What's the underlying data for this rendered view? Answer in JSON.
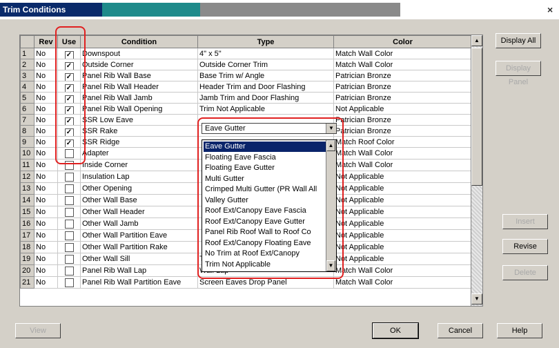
{
  "window": {
    "title": "Trim Conditions",
    "close_glyph": "×"
  },
  "grid": {
    "columns": [
      "",
      "Rev",
      "Use",
      "Condition",
      "Type",
      "Color"
    ],
    "rows": [
      {
        "n": "1",
        "rev": "No",
        "use": true,
        "condition": "Downspout",
        "type": "4\" x 5\"",
        "color": "Match Wall Color"
      },
      {
        "n": "2",
        "rev": "No",
        "use": true,
        "condition": "Outside Corner",
        "type": "Outside Corner Trim",
        "color": "Match Wall Color"
      },
      {
        "n": "3",
        "rev": "No",
        "use": true,
        "condition": "Panel Rib Wall Base",
        "type": "Base Trim w/ Angle",
        "color": "Patrician Bronze"
      },
      {
        "n": "4",
        "rev": "No",
        "use": true,
        "condition": "Panel Rib Wall Header",
        "type": "Header Trim and Door Flashing",
        "color": "Patrician Bronze"
      },
      {
        "n": "5",
        "rev": "No",
        "use": true,
        "condition": "Panel Rib Wall Jamb",
        "type": "Jamb Trim and Door Flashing",
        "color": "Patrician Bronze"
      },
      {
        "n": "6",
        "rev": "No",
        "use": true,
        "condition": "Panel Rib Wall Opening",
        "type": "Trim Not Applicable",
        "color": "Not Applicable"
      },
      {
        "n": "7",
        "rev": "No",
        "use": true,
        "condition": "SSR Low Eave",
        "type": "",
        "color": "Patrician Bronze"
      },
      {
        "n": "8",
        "rev": "No",
        "use": true,
        "condition": "SSR Rake",
        "type": "",
        "color": "Patrician Bronze"
      },
      {
        "n": "9",
        "rev": "No",
        "use": true,
        "condition": "SSR Ridge",
        "type": "",
        "color": "Match Roof Color"
      },
      {
        "n": "10",
        "rev": "No",
        "use": false,
        "condition": "Adapter",
        "type": "",
        "color": "Match Wall Color"
      },
      {
        "n": "11",
        "rev": "No",
        "use": false,
        "condition": "Inside Corner",
        "type": "",
        "color": "Match Wall Color"
      },
      {
        "n": "12",
        "rev": "No",
        "use": false,
        "condition": "Insulation Lap",
        "type": "",
        "color": "Not Applicable"
      },
      {
        "n": "13",
        "rev": "No",
        "use": false,
        "condition": "Other Opening",
        "type": "",
        "color": "Not Applicable"
      },
      {
        "n": "14",
        "rev": "No",
        "use": false,
        "condition": "Other Wall Base",
        "type": "",
        "color": "Not Applicable"
      },
      {
        "n": "15",
        "rev": "No",
        "use": false,
        "condition": "Other Wall Header",
        "type": "",
        "color": "Not Applicable"
      },
      {
        "n": "16",
        "rev": "No",
        "use": false,
        "condition": "Other Wall Jamb",
        "type": "",
        "color": "Not Applicable"
      },
      {
        "n": "17",
        "rev": "No",
        "use": false,
        "condition": "Other Wall Partition Eave",
        "type": "",
        "color": "Not Applicable"
      },
      {
        "n": "18",
        "rev": "No",
        "use": false,
        "condition": "Other Wall Partition Rake",
        "type": "",
        "color": "Not Applicable"
      },
      {
        "n": "19",
        "rev": "No",
        "use": false,
        "condition": "Other Wall Sill",
        "type": "Trim Not Applicable",
        "color": "Not Applicable"
      },
      {
        "n": "20",
        "rev": "No",
        "use": false,
        "condition": "Panel Rib Wall Lap",
        "type": "Wall Lap",
        "color": "Match Wall Color"
      },
      {
        "n": "21",
        "rev": "No",
        "use": false,
        "condition": "Panel Rib Wall Partition Eave",
        "type": "Screen Eaves Drop Panel",
        "color": "Match Wall Color"
      }
    ]
  },
  "combo": {
    "value": "Eave Gutter"
  },
  "dropdown": {
    "items": [
      "Eave Gutter",
      "Floating Eave Fascia",
      "Floating Eave Gutter",
      "Multi Gutter",
      "Crimped Multi Gutter (PR Wall All",
      "Valley Gutter",
      "Roof Ext/Canopy Eave Fascia",
      "Roof Ext/Canopy Eave Gutter",
      "Panel Rib Roof Wall to Roof Co",
      "Roof Ext/Canopy Floating Eave",
      "No Trim at Roof Ext/Canopy",
      "Trim Not Applicable"
    ],
    "selected": 0
  },
  "buttons": {
    "display_all": "Display All",
    "display_panel": "Display Panel",
    "insert": "Insert",
    "revise": "Revise",
    "delete": "Delete",
    "view": "View",
    "ok": "OK",
    "cancel": "Cancel",
    "help": "Help"
  },
  "colors": {
    "highlight": "#e02020",
    "selection": "#0a246a"
  }
}
